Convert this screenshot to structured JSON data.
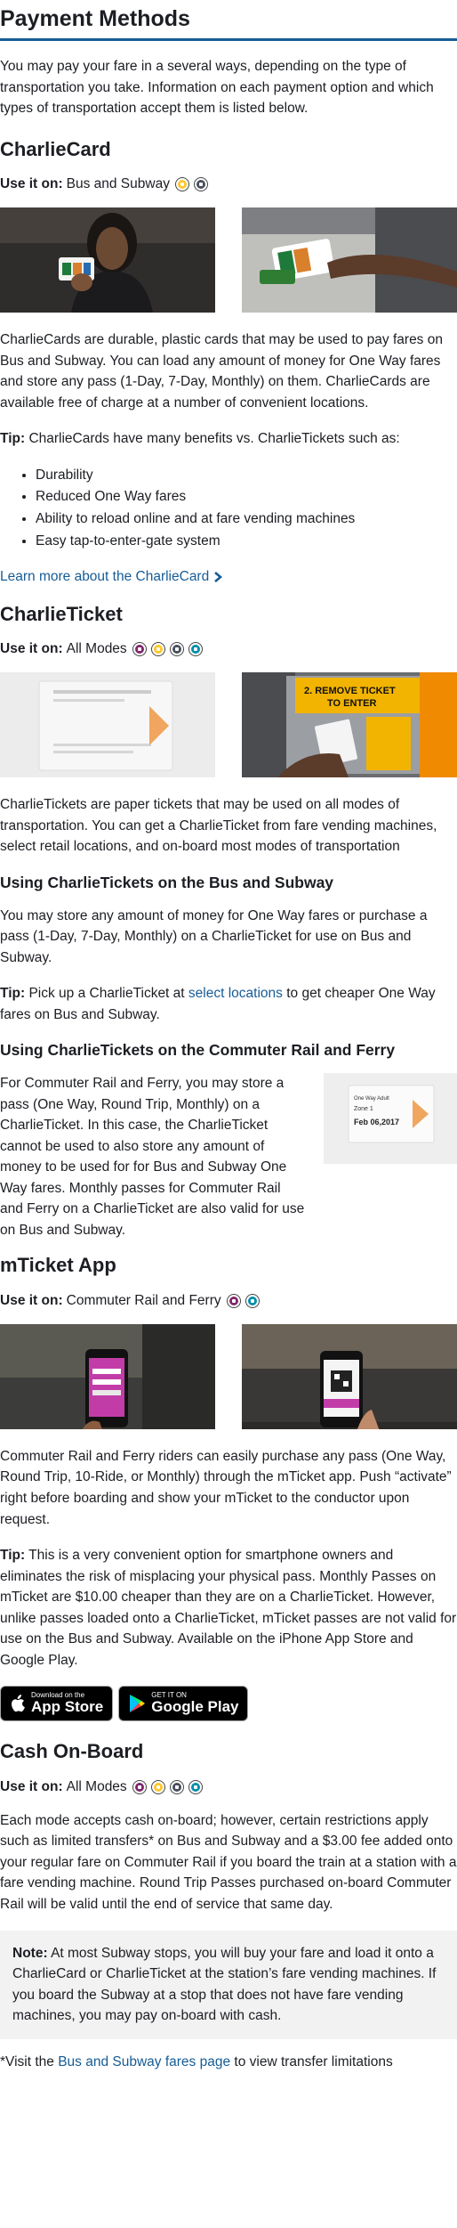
{
  "page_title": "Payment Methods",
  "intro": "You may pay your fare in a several ways, depending on the type of transportation you take. Information on each payment option and which types of transportation accept them is listed below.",
  "use_label": "Use it on:",
  "colors": {
    "link": "#165c96",
    "bus": "#ffc72c",
    "subway": "#494f5c",
    "commuter_rail": "#80276c",
    "ferry": "#008eaa"
  },
  "charliecard": {
    "title": "CharlieCard",
    "modes": "Bus and Subway",
    "mode_icons": [
      "bus-icon",
      "subway-icon"
    ],
    "description": "CharlieCards are durable, plastic cards that may be used to pay fares on Bus and Subway. You can load any amount of money for One Way fares and store any pass (1-Day, 7-Day, Monthly) on them. CharlieCards are available free of charge at a number of convenient locations.",
    "tip_label": "Tip:",
    "tip": "CharlieCards have many benefits vs. CharlieTickets such as:",
    "benefits": [
      "Durability",
      "Reduced One Way fares",
      "Ability to reload online and at fare vending machines",
      "Easy tap-to-enter-gate system"
    ],
    "learn_more": "Learn more about the CharlieCard"
  },
  "charlieticket": {
    "title": "CharlieTicket",
    "modes": "All Modes",
    "mode_icons": [
      "commuter-rail-icon",
      "bus-icon",
      "subway-icon",
      "ferry-icon"
    ],
    "gate_sign": "2. REMOVE TICKET TO ENTER",
    "description": "CharlieTickets are paper tickets that may be used on all modes of transportation. You can get a CharlieTicket from fare vending machines, select retail locations, and on-board most modes of transportation",
    "bus_subway": {
      "title": "Using CharlieTickets on the Bus and Subway",
      "text": "You may store any amount of money for One Way fares or purchase a pass (1-Day, 7-Day, Monthly) on a CharlieTicket for use on Bus and Subway.",
      "tip_label": "Tip:",
      "tip_before": "Pick up a CharlieTicket at",
      "tip_link": "select locations",
      "tip_after": "to get cheaper One Way fares on Bus and Subway."
    },
    "rail_ferry": {
      "title": "Using CharlieTickets on the Commuter Rail and Ferry",
      "text": "For Commuter Rail and Ferry, you may store a pass (One Way, Round Trip, Monthly) on a CharlieTicket. In this case, the CharlieTicket cannot be used to also store any amount of money to be used for for Bus and Subway One Way fares. Monthly passes for Commuter Rail and Ferry on a CharlieTicket are also valid for use on Bus and Subway.",
      "ticket_line1": "One Way Adult",
      "ticket_line2": "Zone 1",
      "ticket_line3": "Feb 06,2017"
    }
  },
  "mticket": {
    "title": "mTicket App",
    "modes": "Commuter Rail and Ferry",
    "mode_icons": [
      "commuter-rail-icon",
      "ferry-icon"
    ],
    "description": "Commuter Rail and Ferry riders can easily purchase any pass (One Way, Round Trip, 10-Ride, or Monthly) through the mTicket app. Push “activate” right before boarding and show your mTicket to the conductor upon request.",
    "tip_label": "Tip:",
    "tip": "This is a very convenient option for smartphone owners and eliminates the risk of misplacing your physical pass. Monthly Passes on mTicket are $10.00 cheaper than they are on a CharlieTicket. However, unlike passes loaded onto a CharlieTicket, mTicket passes are not valid for use on the Bus and Subway. Available on the iPhone App Store and Google Play.",
    "app_store_small": "Download on the",
    "app_store_big": "App Store",
    "google_play_small": "GET IT ON",
    "google_play_big": "Google Play"
  },
  "cash": {
    "title": "Cash On-Board",
    "modes": "All Modes",
    "mode_icons": [
      "commuter-rail-icon",
      "bus-icon",
      "subway-icon",
      "ferry-icon"
    ],
    "description": "Each mode accepts cash on-board; however, certain restrictions apply such as limited transfers* on Bus and Subway and a $3.00 fee added onto your regular fare on Commuter Rail if you board the train at a station with a fare vending machine. Round Trip Passes purchased on-board Commuter Rail will be valid until the end of service that same day.",
    "note_label": "Note:",
    "note": "At most Subway stops, you will buy your fare and load it onto a CharlieCard or CharlieTicket at the station’s fare vending machines. If you board the Subway at a stop that does not have fare vending machines, you may pay on-board with cash.",
    "footnote_before": "*Visit the",
    "footnote_link": "Bus and Subway fares page",
    "footnote_after": "to view transfer limitations"
  }
}
